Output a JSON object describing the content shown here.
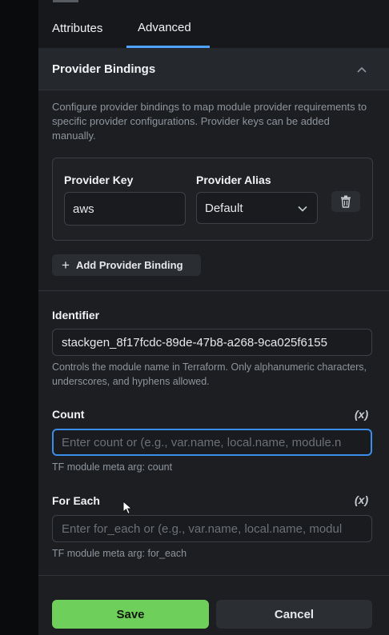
{
  "tabs": [
    {
      "label": "Attributes",
      "active": false
    },
    {
      "label": "Advanced",
      "active": true
    }
  ],
  "provider_bindings": {
    "title": "Provider Bindings",
    "description": "Configure provider bindings to map module provider requirements to specific provider configurations. Provider keys can be added manually.",
    "key_label": "Provider Key",
    "alias_label": "Provider Alias",
    "rows": [
      {
        "key": "aws",
        "alias": "Default"
      }
    ],
    "add_label": "Add Provider Binding"
  },
  "identifier": {
    "label": "Identifier",
    "value": "stackgen_8f17fcdc-89de-47b8-a268-9ca025f6155",
    "help": "Controls the module name in Terraform. Only alphanumeric characters, underscores, and hyphens allowed."
  },
  "count": {
    "label": "Count",
    "var_label": "(x)",
    "placeholder": "Enter count or (e.g., var.name, local.name, module.n",
    "help": "TF module meta arg: count"
  },
  "for_each": {
    "label": "For Each",
    "var_label": "(x)",
    "placeholder": "Enter for_each or (e.g., var.name, local.name, modul",
    "help": "TF module meta arg: for_each"
  },
  "footer": {
    "save_label": "Save",
    "cancel_label": "Cancel"
  },
  "colors": {
    "accent": "#4ea3ff",
    "save": "#6fcf5b",
    "focus": "#3b8dea"
  }
}
